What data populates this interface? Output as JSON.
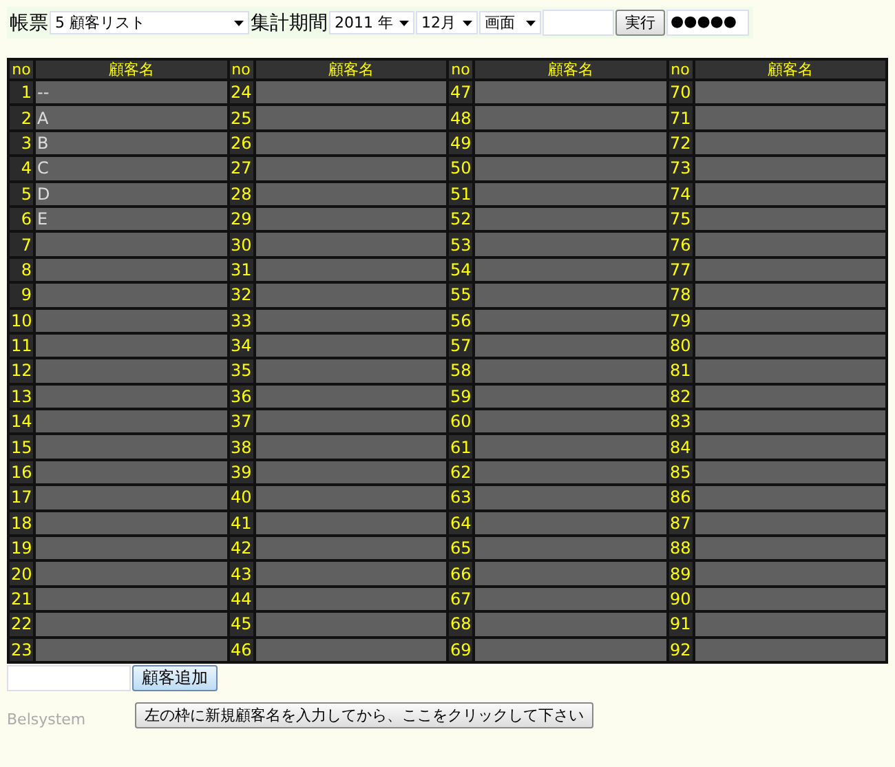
{
  "toolbar": {
    "report_label": "帳票",
    "report_select": "5 顧客リスト",
    "period_label": "集計期間",
    "year_select": "2011 年",
    "month_select": "12月",
    "output_select": "画面",
    "run_button": "実行",
    "password": "●●●●●"
  },
  "table": {
    "columns": [
      "no",
      "顧客名",
      "no",
      "顧客名",
      "no",
      "顧客名",
      "no",
      "顧客名"
    ],
    "customers": [
      {
        "no": "1",
        "name": "--"
      },
      {
        "no": "2",
        "name": "A"
      },
      {
        "no": "3",
        "name": "B"
      },
      {
        "no": "4",
        "name": "C"
      },
      {
        "no": "5",
        "name": "D"
      },
      {
        "no": "6",
        "name": "E"
      },
      {
        "no": "7"
      },
      {
        "no": "8"
      },
      {
        "no": "9"
      },
      {
        "no": "10"
      },
      {
        "no": "11"
      },
      {
        "no": "12"
      },
      {
        "no": "13"
      },
      {
        "no": "14"
      },
      {
        "no": "15"
      },
      {
        "no": "16"
      },
      {
        "no": "17"
      },
      {
        "no": "18"
      },
      {
        "no": "19"
      },
      {
        "no": "20"
      },
      {
        "no": "21"
      },
      {
        "no": "22"
      },
      {
        "no": "23"
      },
      {
        "no": "24"
      },
      {
        "no": "25"
      },
      {
        "no": "26"
      },
      {
        "no": "27"
      },
      {
        "no": "28"
      },
      {
        "no": "29"
      },
      {
        "no": "30"
      },
      {
        "no": "31"
      },
      {
        "no": "32"
      },
      {
        "no": "33"
      },
      {
        "no": "34"
      },
      {
        "no": "35"
      },
      {
        "no": "36"
      },
      {
        "no": "37"
      },
      {
        "no": "38"
      },
      {
        "no": "39"
      },
      {
        "no": "40"
      },
      {
        "no": "41"
      },
      {
        "no": "42"
      },
      {
        "no": "43"
      },
      {
        "no": "44"
      },
      {
        "no": "45"
      },
      {
        "no": "46"
      },
      {
        "no": "47"
      },
      {
        "no": "48"
      },
      {
        "no": "49"
      },
      {
        "no": "50"
      },
      {
        "no": "51"
      },
      {
        "no": "52"
      },
      {
        "no": "53"
      },
      {
        "no": "54"
      },
      {
        "no": "55"
      },
      {
        "no": "56"
      },
      {
        "no": "57"
      },
      {
        "no": "58"
      },
      {
        "no": "59"
      },
      {
        "no": "60"
      },
      {
        "no": "61"
      },
      {
        "no": "62"
      },
      {
        "no": "63"
      },
      {
        "no": "64"
      },
      {
        "no": "65"
      },
      {
        "no": "66"
      },
      {
        "no": "67"
      },
      {
        "no": "68"
      },
      {
        "no": "69"
      },
      {
        "no": "70"
      },
      {
        "no": "71"
      },
      {
        "no": "72"
      },
      {
        "no": "73"
      },
      {
        "no": "74"
      },
      {
        "no": "75"
      },
      {
        "no": "76"
      },
      {
        "no": "77"
      },
      {
        "no": "78"
      },
      {
        "no": "79"
      },
      {
        "no": "80"
      },
      {
        "no": "81"
      },
      {
        "no": "82"
      },
      {
        "no": "83"
      },
      {
        "no": "84"
      },
      {
        "no": "85"
      },
      {
        "no": "86"
      },
      {
        "no": "87"
      },
      {
        "no": "88"
      },
      {
        "no": "89"
      },
      {
        "no": "90"
      },
      {
        "no": "91"
      },
      {
        "no": "92"
      }
    ]
  },
  "add_form": {
    "add_button": "顧客追加",
    "hint_button": "左の枠に新規顧客名を入力してから、ここをクリックして下さい"
  },
  "footer": {
    "brand": "Belsystem"
  }
}
